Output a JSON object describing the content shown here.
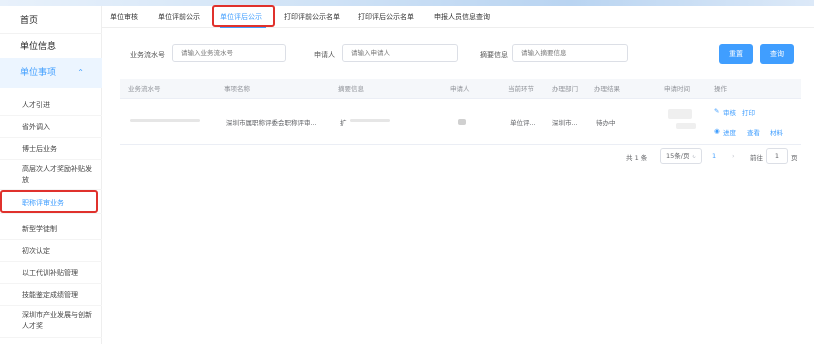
{
  "sidebar": {
    "home": "首页",
    "unit_info": "单位信息",
    "unit_matters": "单位事项",
    "items": [
      "人才引进",
      "省外调入",
      "博士后业务",
      "高层次人才奖励补贴发放",
      "职称评审业务",
      "新型学徒制",
      "初次认定",
      "以工代训补贴管理",
      "技能鉴定成绩管理",
      "深圳市产业发展与创新人才奖"
    ]
  },
  "tabs": [
    "单位审核",
    "单位评前公示",
    "单位评后公示",
    "打印评前公示名单",
    "打印评后公示名单",
    "申报人员信息查询"
  ],
  "filters": {
    "business_no_label": "业务流水号",
    "business_no_placeholder": "请输入业务流水号",
    "applicant_label": "申请人",
    "applicant_placeholder": "请输入申请人",
    "summary_label": "摘要信息",
    "summary_placeholder": "请输入摘要信息",
    "reset": "重置",
    "query": "查询"
  },
  "table": {
    "headers": [
      "业务流水号",
      "事项名称",
      "摘要信息",
      "申请人",
      "当前环节",
      "办理部门",
      "办理结果",
      "申请时间",
      "操作"
    ],
    "rows": [
      {
        "matter": "深圳市属职称评委会职称评审...",
        "summary": "扩",
        "step": "单位评...",
        "dept": "深圳市...",
        "result": "待办中",
        "actions": [
          "审核",
          "打印",
          "进度",
          "查看",
          "材料"
        ]
      }
    ]
  },
  "pagination": {
    "total": "共 1 条",
    "page_size": "15条/页",
    "current": "1",
    "goto_label": "前往",
    "goto_value": "1",
    "page_unit": "页"
  },
  "colors": {
    "accent": "#409eff",
    "highlight": "#e0312c"
  }
}
